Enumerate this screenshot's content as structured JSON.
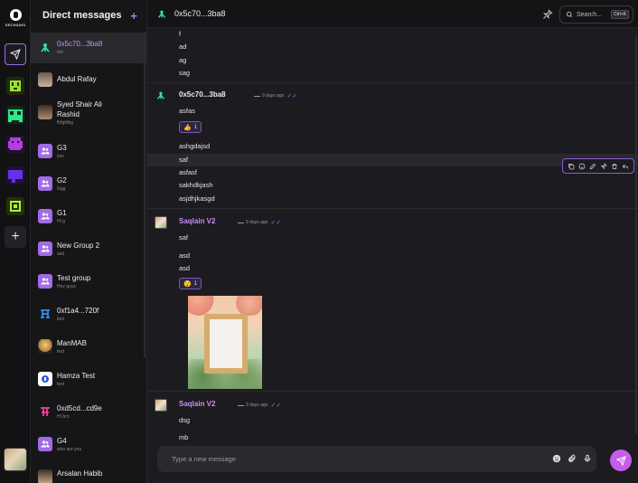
{
  "rail": {
    "logo_text": "DECHAINS",
    "servers": [
      {
        "icon": "green-pixel-monster-icon",
        "color": "#9be22d",
        "bg": "#1f2a10"
      },
      {
        "icon": "teal-pixel-monster-icon",
        "color": "#2ee88a",
        "bg": "#0f2a1e"
      },
      {
        "icon": "magenta-pixel-monster-icon",
        "color": "#b13ee0",
        "bg": "#25102e"
      },
      {
        "icon": "purple-chat-icon",
        "color": "#6b2ee8",
        "bg": "#1c1235"
      },
      {
        "icon": "lime-pixel-monster-icon",
        "color": "#b7f02d",
        "bg": "#23300f"
      }
    ]
  },
  "sidebar": {
    "title": "Direct messages",
    "items": [
      {
        "name": "0x5c70...3ba8",
        "sub": "mb",
        "avatar": "tripod-icon",
        "selected": true,
        "purple": true
      },
      {
        "name": "Abdul Rafay",
        "sub": "",
        "avatar": "photo-avatar"
      },
      {
        "name": "Syed Shair Ali Rashid",
        "sub": "fhfghfbg",
        "avatar": "photo-avatar"
      },
      {
        "name": "G3",
        "sub": "yes",
        "avatar": "group-icon"
      },
      {
        "name": "G2",
        "sub": "Ggg",
        "avatar": "group-icon"
      },
      {
        "name": "G1",
        "sub": "Hi g",
        "avatar": "group-icon"
      },
      {
        "name": "New Group 2",
        "sub": "asd",
        "avatar": "group-icon"
      },
      {
        "name": "Test group",
        "sub": "Hey guys",
        "avatar": "group-icon"
      },
      {
        "name": "0xf1a4...720f",
        "sub": "test",
        "avatar": "blue-glyph-icon"
      },
      {
        "name": "ManMAB",
        "sub": "test",
        "avatar": "photo-avatar"
      },
      {
        "name": "Hamza Test",
        "sub": "test",
        "avatar": "logo-avatar"
      },
      {
        "name": "0xd5cd...cd9e",
        "sub": "HI bro",
        "avatar": "pink-glyph-icon"
      },
      {
        "name": "G4",
        "sub": "who are you",
        "avatar": "group-icon"
      },
      {
        "name": "Arsalan Habib",
        "sub": "",
        "avatar": "photo-avatar"
      }
    ]
  },
  "header": {
    "peer": "0x5c70...3ba8",
    "search_label": "Search...",
    "search_shortcut": "Ctrl+K"
  },
  "messages": {
    "top_lines": [
      "f",
      "ad",
      "ag",
      "sag"
    ],
    "group1": {
      "sender": "0x5c70...3ba8",
      "time": "9 days ago",
      "line1": "asfas",
      "reaction": {
        "emoji": "👍",
        "count": "1"
      },
      "lines": [
        "ashgdajsd",
        "saf",
        "asfasf",
        "sakhdkjash",
        "asjdhjkasgd"
      ]
    },
    "group2": {
      "sender": "Saqlain V2",
      "time": "9 days ago",
      "lines": [
        "saf",
        "asd",
        "asd"
      ],
      "reaction": {
        "emoji": "😯",
        "count": "1"
      }
    },
    "group3": {
      "sender": "Saqlain V2",
      "time": "3 days ago",
      "lines": [
        "dsg",
        "mb"
      ]
    }
  },
  "composer": {
    "placeholder": "Type a new message"
  },
  "colors": {
    "accent": "#c45ee8",
    "purple_name": "#c88ef0",
    "peer_icon": "#2ee8a0"
  }
}
